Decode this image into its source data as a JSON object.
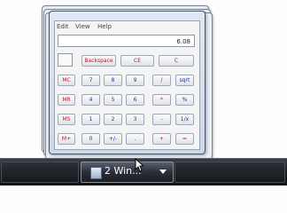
{
  "menu": [
    "Edit",
    "View",
    "Help"
  ],
  "display_value": "6.08",
  "controls": [
    "Backspace",
    "CE",
    "C"
  ],
  "memory_buttons": [
    "MC",
    "MR",
    "MS",
    "M+"
  ],
  "digit_rows": [
    [
      "7",
      "8",
      "9",
      "/",
      "sqrt"
    ],
    [
      "4",
      "5",
      "6",
      "*",
      "%"
    ],
    [
      "1",
      "2",
      "3",
      "-",
      "1/x"
    ],
    [
      "0",
      "+/-",
      ".",
      "+",
      "="
    ]
  ],
  "taskbar": {
    "group_label": "2 Win...",
    "icon": "calculator-icon"
  }
}
